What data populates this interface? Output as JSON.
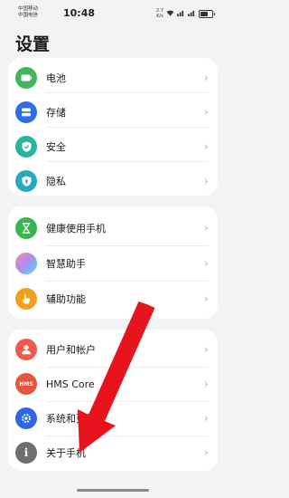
{
  "status_bar": {
    "carrier_1": "中国移动",
    "carrier_2": "中国电信",
    "time": "10:48",
    "net_speed": "2.7",
    "net_unit": "K/s",
    "signal_text": "⁴ᴳ",
    "battery_level": 0.7
  },
  "page": {
    "title": "设置"
  },
  "groups": [
    {
      "items": [
        {
          "label": "电池",
          "icon": "battery-icon",
          "color": "#3fb65a"
        },
        {
          "label": "存储",
          "icon": "storage-icon",
          "color": "#2f6ee8"
        },
        {
          "label": "安全",
          "icon": "shield-icon",
          "color": "#26b5a0"
        },
        {
          "label": "隐私",
          "icon": "privacy-icon",
          "color": "#2aa7b8"
        }
      ]
    },
    {
      "items": [
        {
          "label": "健康使用手机",
          "icon": "hourglass-icon",
          "color": "#39b74f"
        },
        {
          "label": "智慧助手",
          "icon": "assistant-icon",
          "color": "#b68be8"
        },
        {
          "label": "辅助功能",
          "icon": "hand-icon",
          "color": "#f1a11c"
        }
      ]
    },
    {
      "items": [
        {
          "label": "用户和帐户",
          "icon": "user-icon",
          "color": "#ee5b4b"
        },
        {
          "label": "HMS Core",
          "icon": "hms-icon",
          "color": "#e6553f",
          "icon_text": "HMS"
        },
        {
          "label": "系统和更新",
          "icon": "gear-icon",
          "color": "#2e67e0"
        },
        {
          "label": "关于手机",
          "icon": "info-icon",
          "color": "#6f6f6f",
          "icon_text": "i"
        }
      ]
    }
  ],
  "chevron": "›",
  "annotation": {
    "color": "#e8141d",
    "type": "arrow"
  }
}
